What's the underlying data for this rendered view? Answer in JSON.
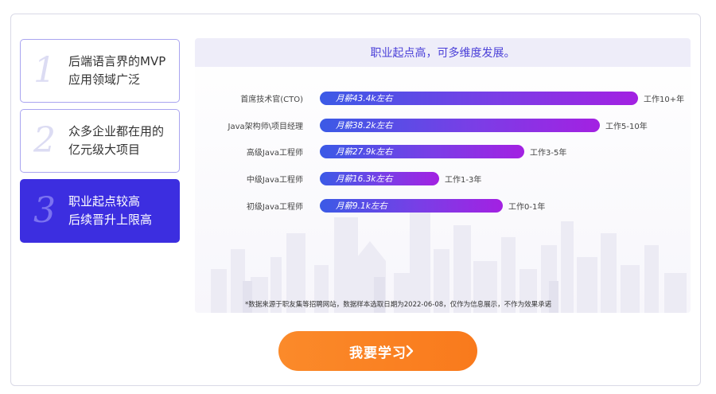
{
  "tabs": [
    {
      "number": "1",
      "line1": "后端语言界的MVP",
      "line2": "应用领域广泛",
      "active": false
    },
    {
      "number": "2",
      "line1": "众多企业都在用的",
      "line2": "亿元级大项目",
      "active": false
    },
    {
      "number": "3",
      "line1": "职业起点较高",
      "line2": "后续晋升上限高",
      "active": true
    }
  ],
  "panel": {
    "title": "职业起点高，可多维度发展。",
    "footnote": "*数据来源于职友集等招聘网站，数据样本选取日期为2022-06-08，仅作为信息展示，不作为效果承诺"
  },
  "chart_data": {
    "type": "bar",
    "orientation": "horizontal",
    "categories": [
      "首席技术官(CTO)",
      "Java架构师\\项目经理",
      "高级Java工程师",
      "中级Java工程师",
      "初级Java工程师"
    ],
    "values": [
      43.4,
      38.2,
      27.9,
      16.3,
      9.1
    ],
    "value_labels": [
      "月薪43.4k左右",
      "月薪38.2k左右",
      "月薪27.9k左右",
      "月薪16.3k左右",
      "月薪9.1k左右"
    ],
    "experience_labels": [
      "工作10+年",
      "工作5-10年",
      "工作3-5年",
      "工作1-3年",
      "工作0-1年"
    ]
  },
  "colors": {
    "accent": "#3c2ee0",
    "bar_start": "#3b5ae6",
    "bar_end": "#a321e2",
    "cta": "#fb8a2a"
  },
  "cta": {
    "label": "我要学习",
    "icon": "chevron-right-icon"
  }
}
